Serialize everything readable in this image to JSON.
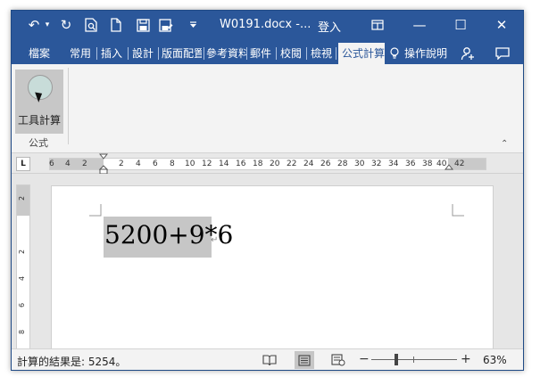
{
  "quick_access": {
    "undo_icon": "↶",
    "dropdown_icon": "▾",
    "redo_icon": "↻",
    "preview_icon": "preview-icon",
    "new_icon": "new-doc-icon",
    "save_icon": "save-icon",
    "saveas_icon": "save-as-icon",
    "customize_icon": "customize-icon"
  },
  "title": {
    "document": "W0191.docx  -...",
    "signin": "登入"
  },
  "window_buttons": {
    "ribbon_options": "▣",
    "minimize": "—",
    "maximize": "☐",
    "close": "✕"
  },
  "tabs": [
    {
      "label": "檔案"
    },
    {
      "label": "常用"
    },
    {
      "label": "插入"
    },
    {
      "label": "設計"
    },
    {
      "label": "版面配置"
    },
    {
      "label": "參考資料"
    },
    {
      "label": "郵件"
    },
    {
      "label": "校閱"
    },
    {
      "label": "檢視"
    },
    {
      "label": "公式計算"
    }
  ],
  "tell_me": "操作說明",
  "ribbon": {
    "tool_button_label": "工具計算",
    "group_label": "公式",
    "collapse_icon": "⌃"
  },
  "ruler": {
    "corner": "L",
    "numbers": [
      "6",
      "4",
      "2",
      "2",
      "4",
      "6",
      "8",
      "10",
      "12",
      "14",
      "16",
      "18",
      "20",
      "22",
      "24",
      "26",
      "28",
      "30",
      "32",
      "34",
      "36",
      "38",
      "40",
      "42"
    ],
    "vertical_numbers": [
      "2",
      "2",
      "4",
      "6",
      "8"
    ]
  },
  "document": {
    "formula": "5200+9*6",
    "paragraph_mark": "↵"
  },
  "status": {
    "result_text": "計算的結果是: 5254。",
    "zoom": "63%",
    "zoom_minus": "−",
    "zoom_plus": "+"
  },
  "colors": {
    "accent": "#2b579a",
    "ribbon_bg": "#f3f3f3"
  }
}
